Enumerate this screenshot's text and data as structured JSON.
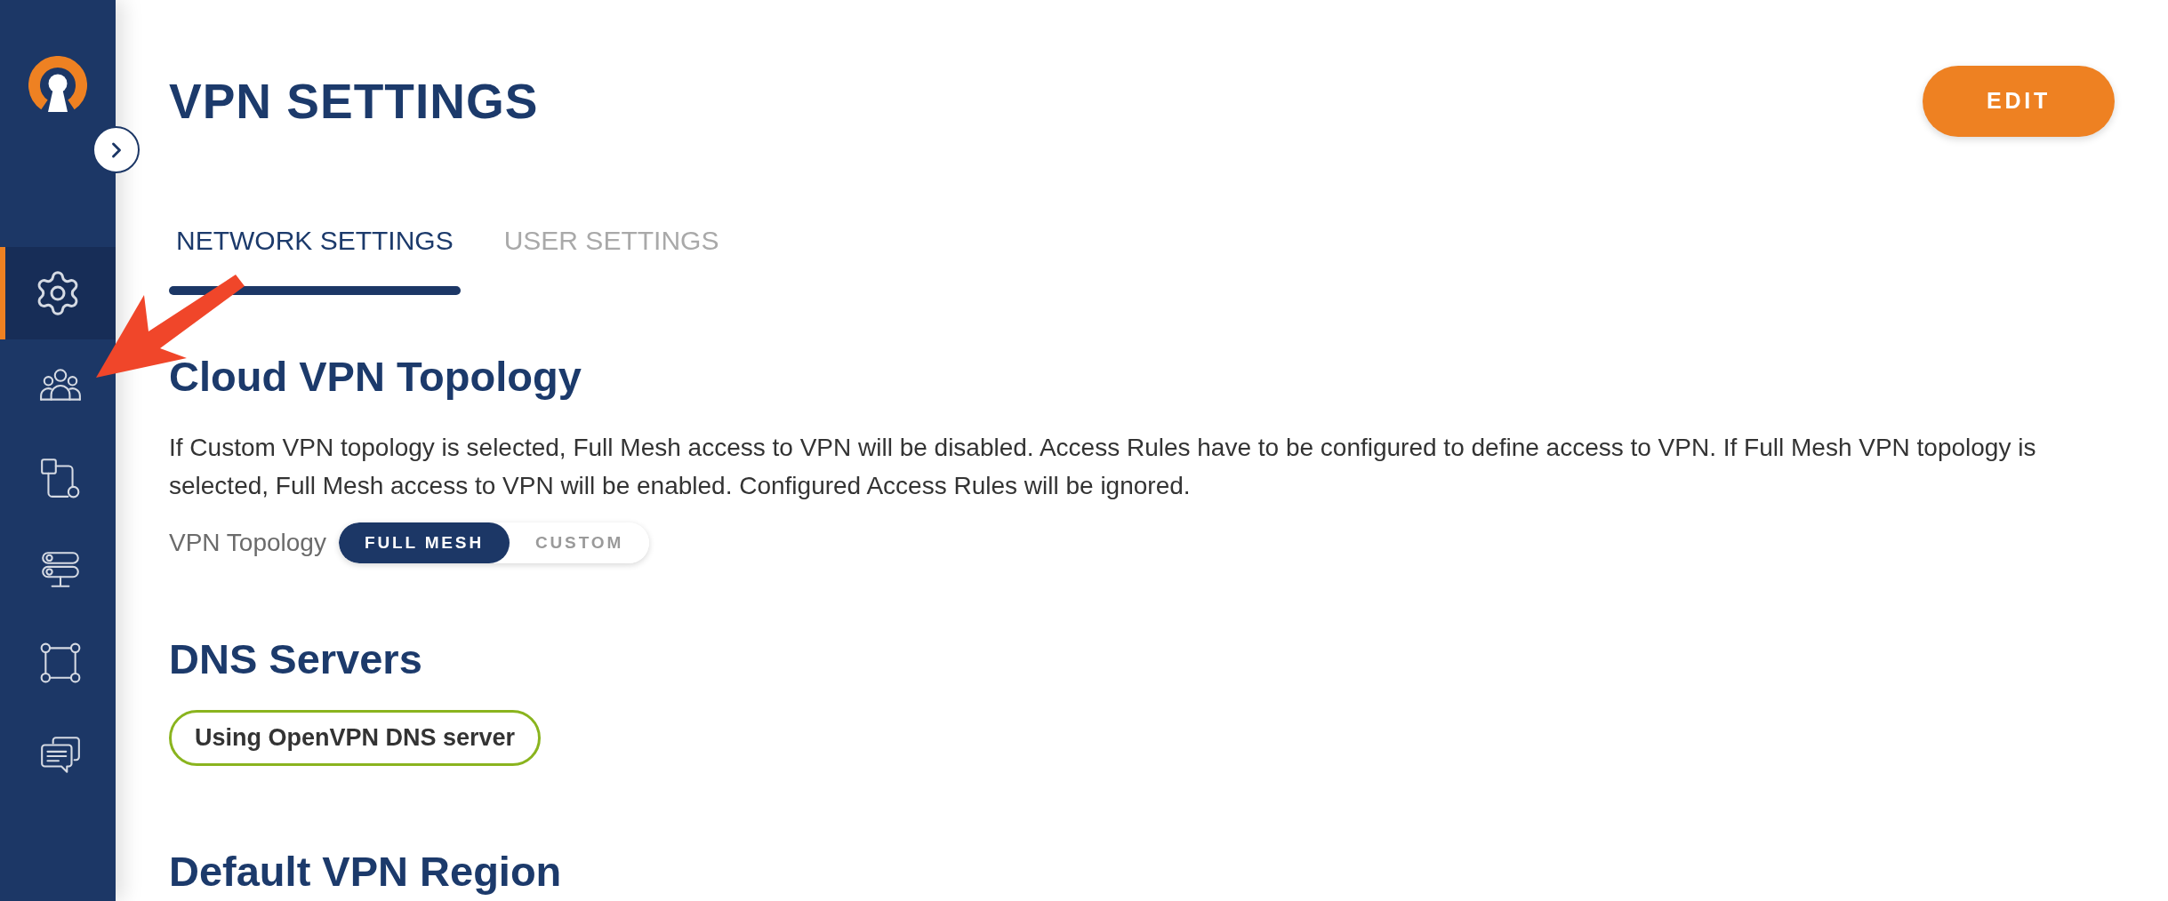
{
  "header": {
    "title": "VPN SETTINGS",
    "edit_button": "EDIT"
  },
  "sidebar": {
    "items": [
      {
        "selected": true
      },
      {
        "selected": false
      },
      {
        "selected": false
      },
      {
        "selected": false
      },
      {
        "selected": false
      },
      {
        "selected": false
      }
    ]
  },
  "tabs": [
    {
      "label": "NETWORK SETTINGS",
      "selected": true
    },
    {
      "label": "USER SETTINGS",
      "selected": false
    }
  ],
  "sections": [
    {
      "kind": "topology",
      "heading": "Cloud VPN Topology",
      "description": "If Custom VPN topology is selected, Full Mesh access to VPN will be disabled. Access Rules have to be configured to define access to VPN. If Full Mesh VPN topology is selected, Full Mesh access to VPN will be enabled. Configured Access Rules will be ignored.",
      "field_label": "VPN Topology",
      "options": [
        {
          "label": "FULL MESH",
          "selected": true
        },
        {
          "label": "CUSTOM",
          "selected": false
        }
      ]
    },
    {
      "kind": "dns",
      "heading": "DNS Servers",
      "status": "Using OpenVPN DNS server"
    },
    {
      "kind": "region",
      "heading": "Default VPN Region"
    }
  ]
}
